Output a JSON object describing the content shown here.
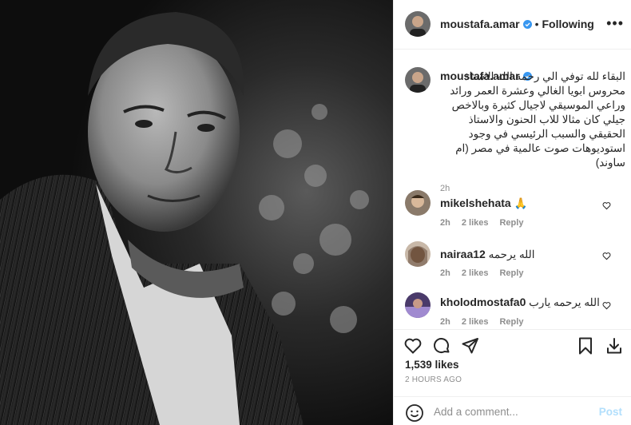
{
  "header": {
    "username": "moustafa.amar",
    "separator": "•",
    "follow_label": "Following",
    "more": "•••"
  },
  "caption": {
    "username": "moustafa.amar",
    "text": "البقاء لله توفي الي رحمة الله الاستاذ محروس ابويا الغالي وعشرة العمر ورائد وراعي الموسيقي لاجيال كثيرة وبالاخص جيلي كان مثالا للاب الحنون والاستاذ الحقيقي والسبب الرئيسي في وجود استوديوهات صوت عالمية في مصر (ام ساوند)",
    "time": "2h"
  },
  "comments": [
    {
      "username": "mikelshehata",
      "text": "🙏",
      "time": "2h",
      "likes": "2 likes",
      "reply": "Reply"
    },
    {
      "username": "nairaa12",
      "text": "الله يرحمه",
      "time": "2h",
      "likes": "2 likes",
      "reply": "Reply"
    },
    {
      "username": "kholodmostafa0",
      "text": "الله يرحمه يارب",
      "time": "2h",
      "likes": "2 likes",
      "reply": "Reply"
    }
  ],
  "actions": {
    "icons": [
      "heart-icon",
      "comment-icon",
      "share-icon",
      "bookmark-icon",
      "download-icon"
    ]
  },
  "likes": "1,539 likes",
  "posted": "2 HOURS AGO",
  "add_comment": {
    "placeholder": "Add a comment...",
    "post_label": "Post"
  },
  "colors": {
    "verified": "#3897f0",
    "post_disabled": "#b2dffc",
    "muted": "#8e8e8e"
  }
}
